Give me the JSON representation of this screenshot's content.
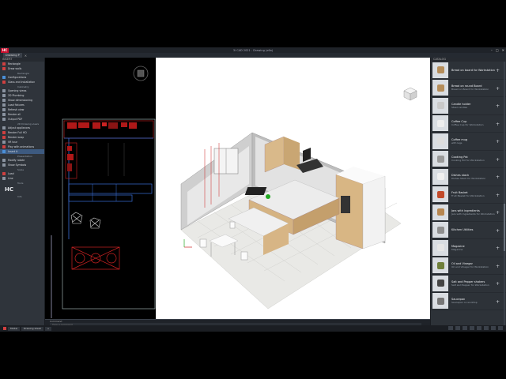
{
  "app": {
    "logo": "HC",
    "title": "3i CAD 2021 - Drawing (x6a)",
    "window_controls": [
      "–",
      "□",
      "✕"
    ]
  },
  "tabs": [
    {
      "label": "Drawing P"
    }
  ],
  "left_panel": {
    "header": "INSERT",
    "items": [
      {
        "label": "Rectangle",
        "icon": "rectangle-icon",
        "color": "red"
      },
      {
        "label": "Draw walls",
        "icon": "walls-icon",
        "color": "red",
        "sub": "Rectangle"
      },
      {
        "label": "Configurations",
        "icon": "config-icon",
        "color": "blue"
      },
      {
        "label": "Glass and installation",
        "icon": "glass-icon",
        "color": "red",
        "sub": "Cabinetry"
      },
      {
        "label": "Opening views",
        "icon": "opening-icon",
        "color": "grey"
      },
      {
        "label": "2D Plumbing",
        "icon": "plumbing-icon",
        "color": "grey"
      },
      {
        "label": "Show dimensioning",
        "icon": "dimension-icon",
        "color": "grey"
      },
      {
        "label": "Load fixtures",
        "icon": "load-icon",
        "color": "grey"
      },
      {
        "label": "Refresh view",
        "icon": "refresh-icon",
        "color": "grey"
      },
      {
        "label": "Render all",
        "icon": "render-icon",
        "color": "grey"
      },
      {
        "label": "Output PDF",
        "icon": "pdf-icon",
        "color": "grey",
        "sub": "2D Drawing views"
      },
      {
        "label": "Adjust appliances",
        "icon": "adjust-icon",
        "color": "grey"
      },
      {
        "label": "Render Full HD",
        "icon": "render-hd-icon",
        "color": "red"
      },
      {
        "label": "Render wrap",
        "icon": "wrap-icon",
        "color": "red"
      },
      {
        "label": "VR tour",
        "icon": "vr-icon",
        "color": "grey"
      },
      {
        "label": "Play with animations",
        "icon": "play-icon",
        "color": "red"
      },
      {
        "label": "Insert it",
        "icon": "insert-icon",
        "color": "blue",
        "selected": true,
        "sub": "Presentation"
      },
      {
        "label": "Modify rotate",
        "icon": "rotate-icon",
        "color": "grey"
      },
      {
        "label": "Show Symbols",
        "icon": "symbols-icon",
        "color": "grey",
        "sub": "Scale"
      },
      {
        "label": "Load",
        "icon": "load2-icon",
        "color": "red"
      },
      {
        "label": "Line",
        "icon": "line-icon",
        "color": "grey",
        "sub": "Tools"
      }
    ],
    "footer_logo": "HC",
    "footer_sub": "Info"
  },
  "right_panel": {
    "header": "CATALOG",
    "items": [
      {
        "name": "Bread on board for Workstation",
        "desc": "",
        "thumb": "bread"
      },
      {
        "name": "Bread on round Board",
        "desc": "Bread on Board for Workstation",
        "thumb": "bread"
      },
      {
        "name": "Candle holder",
        "desc": "Steel candles",
        "thumb": "candle"
      },
      {
        "name": "Coffee Cup",
        "desc": "Coffee Cup for Workstation",
        "thumb": "cup"
      },
      {
        "name": "Coffee mug",
        "desc": "with legs",
        "thumb": "mug"
      },
      {
        "name": "Cooking Pot",
        "desc": "Cooking Pot for Workstation",
        "thumb": "pot"
      },
      {
        "name": "Dishes stack",
        "desc": "Dishes Stack for Workstation",
        "thumb": "dishes"
      },
      {
        "name": "Fruit Basket",
        "desc": "Fruit Basket for Workstation",
        "thumb": "fruit"
      },
      {
        "name": "Jars with ingredients",
        "desc": "Jars with Ingredients for Workstation",
        "thumb": "jars"
      },
      {
        "name": "Kitchen Utilities",
        "desc": "",
        "thumb": "utilities"
      },
      {
        "name": "Magazine",
        "desc": "Magazine",
        "thumb": "magazine"
      },
      {
        "name": "Oil and Vinegar",
        "desc": "Oil and Vinegar for Workstation",
        "thumb": "oil"
      },
      {
        "name": "Salt and Pepper shakers",
        "desc": "Salt and Pepper for Workstation",
        "thumb": "salt"
      },
      {
        "name": "Saucepan",
        "desc": "Saucepan on worktop",
        "thumb": "saucepan"
      }
    ]
  },
  "command": {
    "label": "Command",
    "placeholder": "Type a command"
  },
  "statusbar": {
    "tabs": [
      "Model",
      "Drawing sheet",
      "+"
    ]
  },
  "colors": {
    "accent": "#c8102e",
    "selection": "#3d5a80",
    "viewport_bg": "#ffffff",
    "cad_bg": "#000000"
  }
}
